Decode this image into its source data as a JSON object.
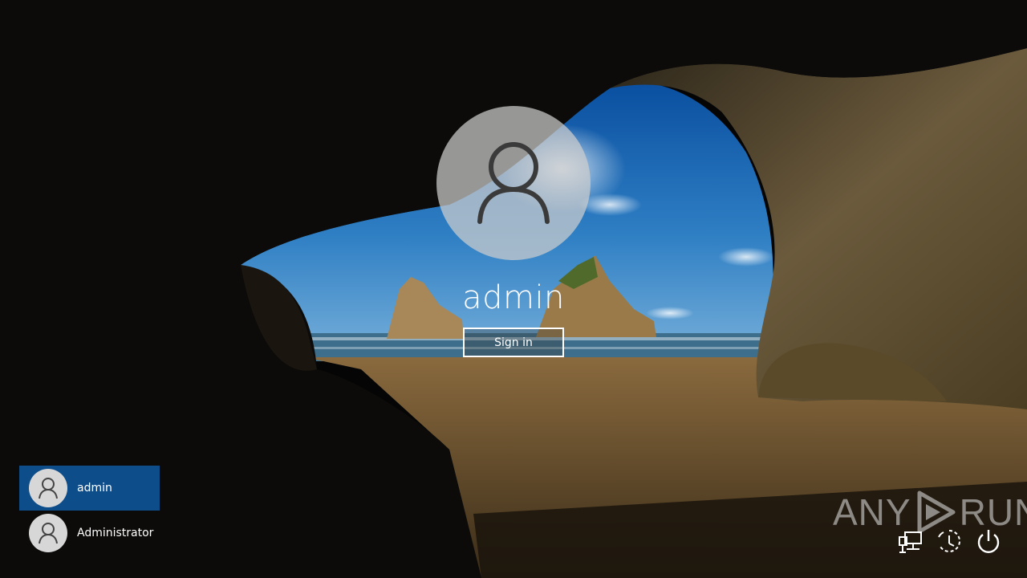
{
  "background": {
    "description": "lock-screen-wallpaper",
    "accent": "#0d4d8a"
  },
  "login": {
    "username": "admin",
    "signin_label": "Sign in"
  },
  "users": [
    {
      "name": "admin",
      "selected": true
    },
    {
      "name": "Administrator",
      "selected": false
    }
  ],
  "watermark": {
    "left": "ANY",
    "right": "RUN"
  },
  "system_icons": [
    "network-icon",
    "ease-of-access-icon",
    "power-icon"
  ]
}
